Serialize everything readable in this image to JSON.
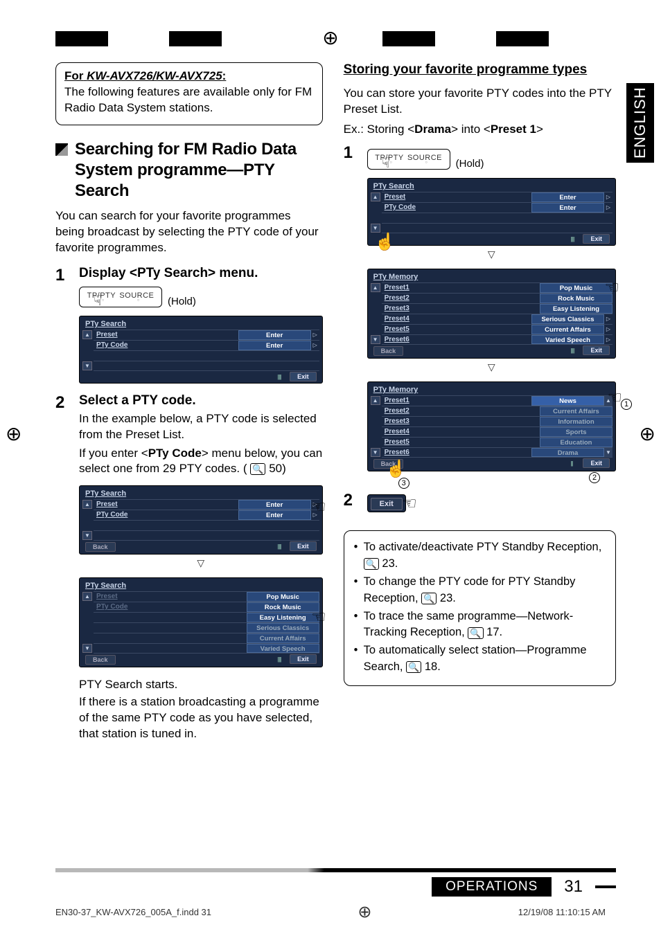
{
  "language_tab": "ENGLISH",
  "note_box": {
    "for_prefix": "For",
    "model": "KW-AVX726/KW-AVX725",
    "colon": ":",
    "text": "The following features are available only for FM Radio Data System stations."
  },
  "section_title": "Searching for FM Radio Data System programme—PTY Search",
  "section_intro": "You can search for your favorite programmes being broadcast by selecting the PTY code of your favorite programmes.",
  "step1": {
    "num": "1",
    "title": "Display <PTy Search> menu.",
    "btn_labels": {
      "left": "TP/PTY",
      "right": "SOURCE"
    },
    "hold": "(Hold)"
  },
  "screen_a": {
    "title": "PTy Search",
    "rows": [
      {
        "label": "Preset",
        "value": "Enter"
      },
      {
        "label": "PTy Code",
        "value": "Enter"
      }
    ],
    "exit": "Exit"
  },
  "step2": {
    "num": "2",
    "title": "Select a PTY code.",
    "body1": "In the example below, a PTY code is selected from the Preset List.",
    "body2_pre": "If you enter <",
    "body2_bold": "PTy Code",
    "body2_post": "> menu below, you can select one from 29 PTY codes. (",
    "body2_page": "50",
    "body2_end": ")"
  },
  "screen_b": {
    "title": "PTy Search",
    "rows": [
      {
        "label": "Preset",
        "value": "Enter"
      },
      {
        "label": "PTy Code",
        "value": "Enter"
      }
    ],
    "back": "Back",
    "exit": "Exit"
  },
  "screen_c": {
    "title": "PTy Search",
    "left": [
      "Preset",
      "PTy Code"
    ],
    "right": [
      "Pop Music",
      "Rock Music",
      "Easy Listening",
      "Serious Classics",
      "Current Affairs",
      "Varied Speech"
    ],
    "back": "Back",
    "exit": "Exit"
  },
  "after_c_1": "PTY Search starts.",
  "after_c_2": "If there is a station broadcasting a programme of the same PTY code as you have selected, that station is tuned in.",
  "right_heading": "Storing your favorite programme types",
  "right_intro": "You can store your favorite PTY codes into the PTY Preset List.",
  "right_example_pre": "Ex.:  Storing <",
  "right_example_b1": "Drama",
  "right_example_mid": "> into <",
  "right_example_b2": "Preset 1",
  "right_example_post": ">",
  "right_step1_num": "1",
  "right_btn_labels": {
    "left": "TP/PTY",
    "right": "SOURCE"
  },
  "right_hold": "(Hold)",
  "screen_r1": {
    "title": "PTy Search",
    "rows": [
      {
        "label": "Preset",
        "value": "Enter"
      },
      {
        "label": "PTy Code",
        "value": "Enter"
      }
    ],
    "exit": "Exit"
  },
  "screen_r2": {
    "title": "PTy  Memory",
    "left": [
      "Preset1",
      "Preset2",
      "Preset3",
      "Preset4",
      "Preset5",
      "Preset6"
    ],
    "right": [
      "Pop Music",
      "Rock Music",
      "Easy Listening",
      "Serious Classics",
      "Current Affairs",
      "Varied Speech"
    ],
    "back": "Back",
    "exit": "Exit"
  },
  "screen_r3": {
    "title": "PTy  Memory",
    "left": [
      "Preset1",
      "Preset2",
      "Preset3",
      "Preset4",
      "Preset5",
      "Preset6"
    ],
    "right": [
      "News",
      "Current Affairs",
      "Information",
      "Sports",
      "Education",
      "Drama"
    ],
    "back": "Back",
    "exit": "Exit",
    "callouts": {
      "c1": "1",
      "c2": "2",
      "c3": "3"
    }
  },
  "right_step2_num": "2",
  "exit_pill": "Exit",
  "bullets": [
    {
      "text_pre": "To activate/deactivate PTY Standby Reception, ",
      "page": "23",
      "text_post": "."
    },
    {
      "text_pre": "To change the PTY code for PTY Standby Reception, ",
      "page": "23",
      "text_post": "."
    },
    {
      "text_pre": "To trace the same programme—Network-Tracking Reception, ",
      "page": "17",
      "text_post": "."
    },
    {
      "text_pre": "To automatically select station—Programme Search, ",
      "page": "18",
      "text_post": "."
    }
  ],
  "operations_label": "OPERATIONS",
  "page_number": "31",
  "footer": {
    "left": "EN30-37_KW-AVX726_005A_f.indd   31",
    "right": "12/19/08   11:10:15 AM"
  }
}
